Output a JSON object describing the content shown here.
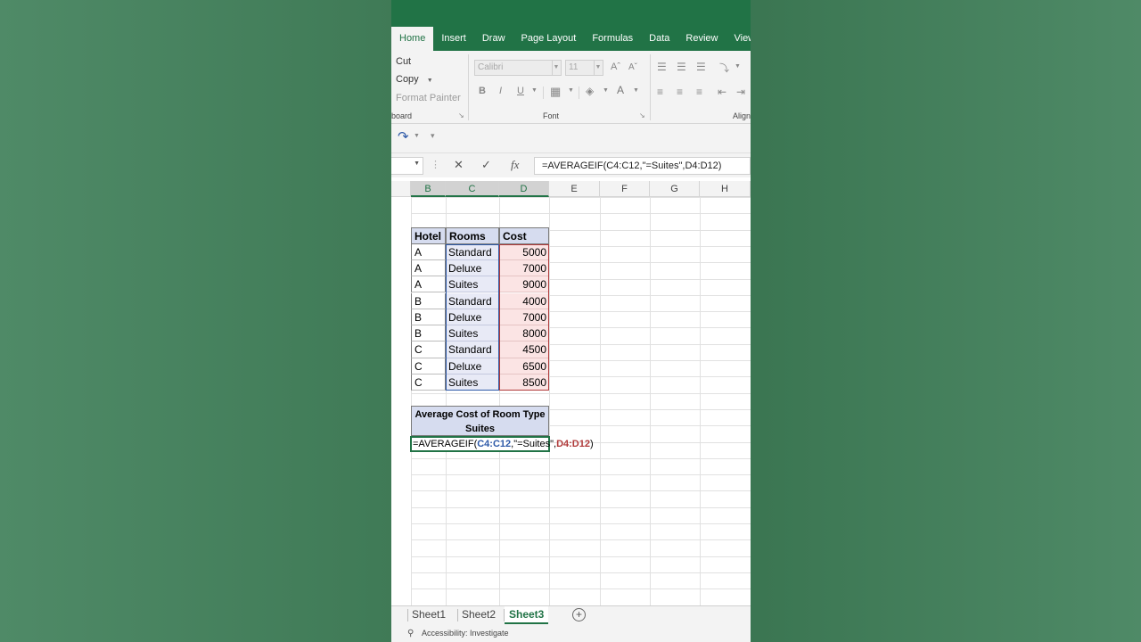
{
  "ribbon_tabs": [
    "Home",
    "Insert",
    "Draw",
    "Page Layout",
    "Formulas",
    "Data",
    "Review",
    "View"
  ],
  "clipboard": {
    "cut": "Cut",
    "copy": "Copy",
    "format_painter": "Format Painter",
    "group_label": "board"
  },
  "font": {
    "name": "Calibri",
    "size": "11",
    "group_label": "Font",
    "bold": "B",
    "italic": "I",
    "underline": "U",
    "font_color": "A"
  },
  "alignment": {
    "group_label": "Align"
  },
  "formula_bar": {
    "fx": "fx",
    "formula": "=AVERAGEIF(C4:C12,\"=Suites\",D4:D12)"
  },
  "columns": [
    "B",
    "C",
    "D",
    "E",
    "F",
    "G",
    "H"
  ],
  "table": {
    "headers": [
      "Hotel",
      "Rooms",
      "Cost"
    ],
    "rows": [
      [
        "A",
        "Standard",
        "5000"
      ],
      [
        "A",
        "Deluxe",
        "7000"
      ],
      [
        "A",
        "Suites",
        "9000"
      ],
      [
        "B",
        "Standard",
        "4000"
      ],
      [
        "B",
        "Deluxe",
        "7000"
      ],
      [
        "B",
        "Suites",
        "8000"
      ],
      [
        "C",
        "Standard",
        "4500"
      ],
      [
        "C",
        "Deluxe",
        "6500"
      ],
      [
        "C",
        "Suites",
        "8500"
      ]
    ]
  },
  "summary": {
    "title_line1": "Average Cost of Room Type",
    "title_line2": "Suites",
    "formula_prefix": "=AVERAGEIF(",
    "formula_ref1": "C4:C12",
    "formula_mid": ",\"=Suites\",",
    "formula_ref2": "D4:D12",
    "formula_suffix": ")"
  },
  "sheets": [
    "Sheet1",
    "Sheet2",
    "Sheet3"
  ],
  "active_sheet": "Sheet3",
  "status": {
    "accessibility": "Accessibility: Investigate"
  },
  "colors": {
    "brand": "#217346",
    "header_fill": "#d6dcef",
    "range1": "#2e5aa8",
    "range2": "#b03a3a"
  }
}
